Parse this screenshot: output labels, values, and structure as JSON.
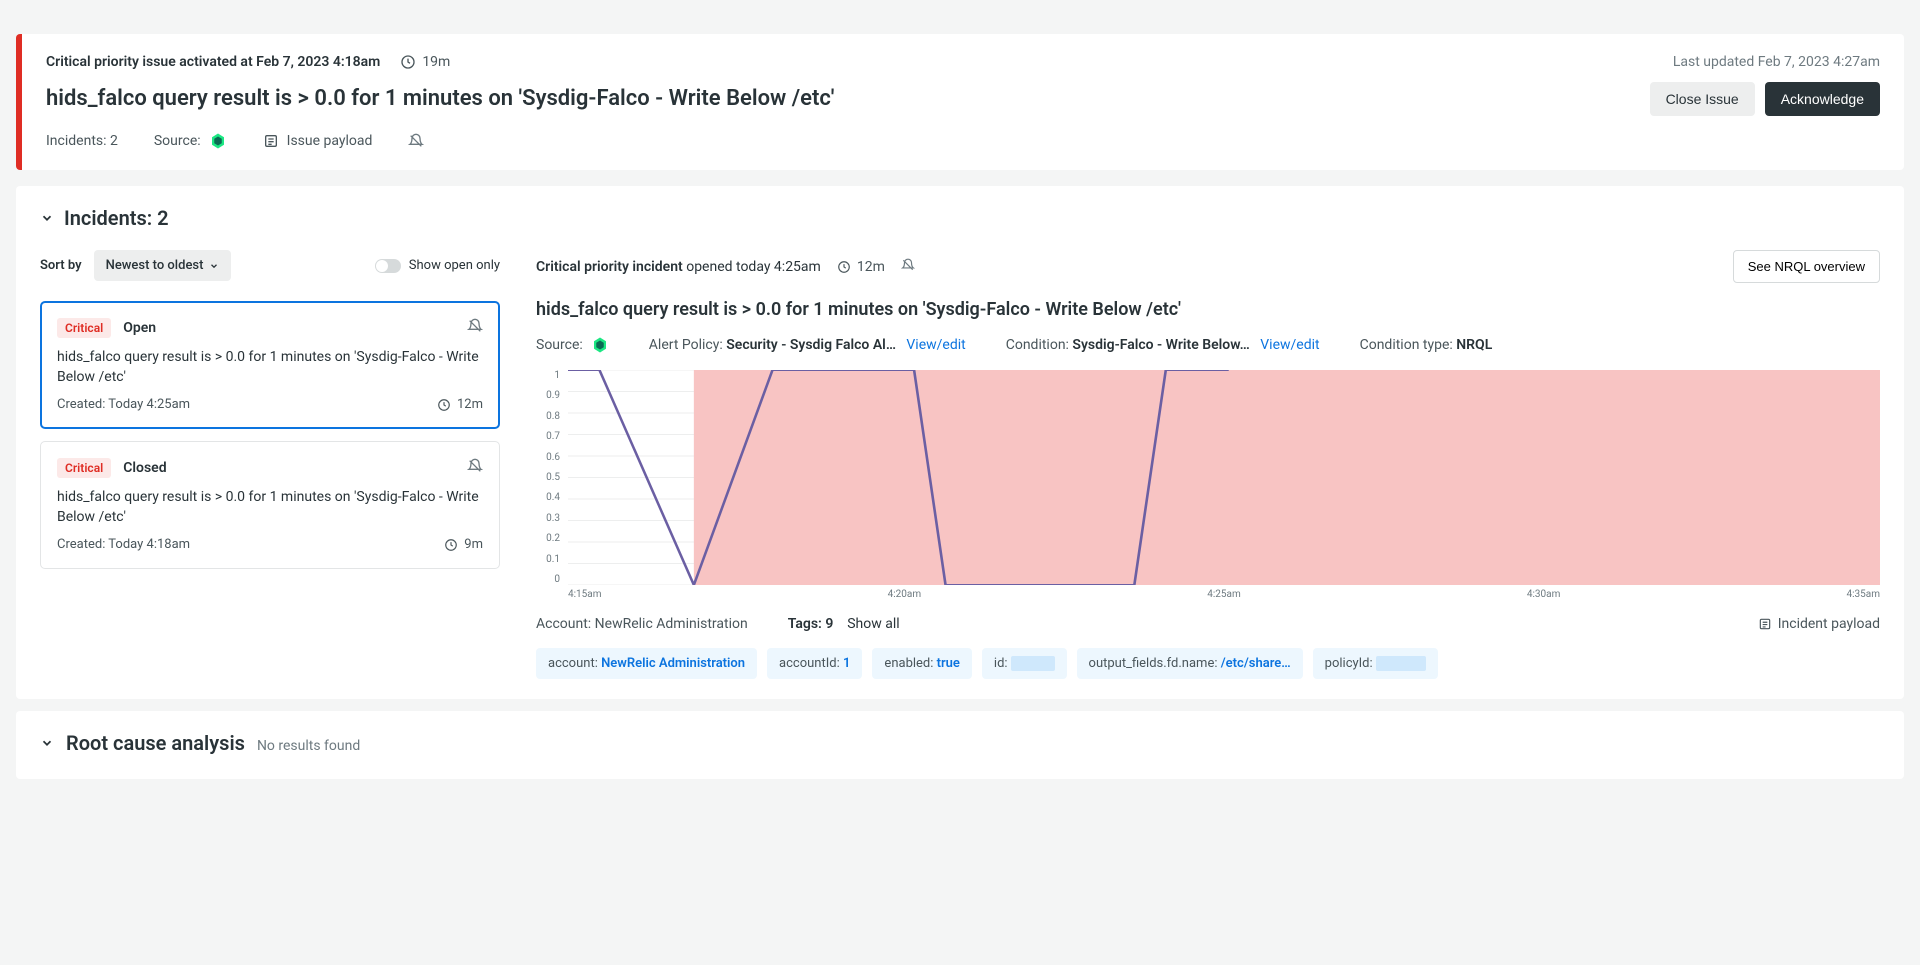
{
  "header": {
    "activated_line": "Critical priority issue activated at Feb 7, 2023 4:18am",
    "age": "19m",
    "last_updated": "Last updated Feb 7, 2023 4:27am",
    "title": "hids_falco query result is > 0.0 for 1 minutes on 'Sysdig-Falco - Write Below /etc'",
    "close_btn": "Close Issue",
    "ack_btn": "Acknowledge"
  },
  "meta": {
    "incidents": "Incidents: 2",
    "source_label": "Source:",
    "issue_payload": "Issue payload"
  },
  "incidents_section": {
    "title": "Incidents: 2",
    "sort_by_label": "Sort by",
    "sort_value": "Newest to oldest",
    "show_open_only": "Show open only",
    "list": [
      {
        "severity": "Critical",
        "status": "Open",
        "desc": "hids_falco query result is > 0.0 for 1 minutes on 'Sysdig-Falco - Write Below /etc'",
        "created": "Created: Today 4:25am",
        "duration": "12m"
      },
      {
        "severity": "Critical",
        "status": "Closed",
        "desc": "hids_falco query result is > 0.0 for 1 minutes on 'Sysdig-Falco - Write Below /etc'",
        "created": "Created: Today 4:18am",
        "duration": "9m"
      }
    ]
  },
  "detail": {
    "opened_line": "Critical priority incident opened today 4:25am",
    "opened_bold_part": "Critical priority incident",
    "opened_rest": " opened today 4:25am",
    "duration": "12m",
    "see_nrql": "See NRQL overview",
    "title": "hids_falco query result is > 0.0 for 1 minutes on 'Sysdig-Falco - Write Below /etc'",
    "source_label": "Source:",
    "alert_policy_label": "Alert Policy: ",
    "alert_policy_value": "Security - Sysdig Falco Al…",
    "view_edit": "View/edit",
    "condition_label": "Condition: ",
    "condition_value": "Sysdig-Falco - Write Below…",
    "condition_type_label": "Condition type: ",
    "condition_type_value": "NRQL",
    "account_line": "Account: NewRelic Administration",
    "tags_summary": "Tags: 9",
    "show_all": "Show all",
    "incident_payload": "Incident payload",
    "tags": {
      "account_k": "account: ",
      "account_v": "NewRelic Administration",
      "accountId_k": "accountId: ",
      "accountId_v": "1",
      "enabled_k": "enabled: ",
      "enabled_v": "true",
      "id_k": "id: ",
      "output_k": "output_fields.fd.name: ",
      "output_v": "/etc/share…",
      "policyId_k": "policyId: "
    }
  },
  "chart_data": {
    "type": "line",
    "x_ticks": [
      "4:15am",
      "4:20am",
      "4:25am",
      "4:30am",
      "4:35am"
    ],
    "y_ticks": [
      "1",
      "0.9",
      "0.8",
      "0.7",
      "0.6",
      "0.5",
      "0.4",
      "0.3",
      "0.2",
      "0.1",
      "0"
    ],
    "ylim": [
      0,
      1
    ],
    "threshold_region_color": "#f8c4c3",
    "threshold_region_y_min": 0.0,
    "threshold_region_x_start": 4.29,
    "threshold_region_x_end": 4.667,
    "series": [
      {
        "name": "hids_falco",
        "color": "#6b5fa3",
        "x": [
          4.25,
          4.26,
          4.29,
          4.315,
          4.36,
          4.37,
          4.43,
          4.44,
          4.46
        ],
        "y": [
          1.0,
          1.0,
          0.0,
          1.0,
          1.0,
          0.0,
          0.0,
          1.0,
          1.0
        ]
      }
    ]
  },
  "rca": {
    "title": "Root cause analysis",
    "sub": "No results found"
  }
}
